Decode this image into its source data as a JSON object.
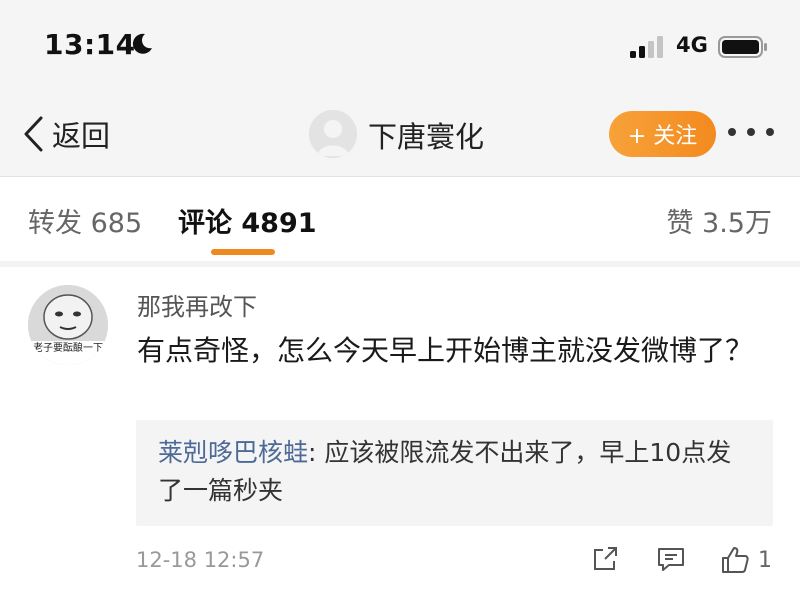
{
  "status_bar": {
    "time": "13:14",
    "network": "4G",
    "moon_icon": "do-not-disturb-moon-icon",
    "signal_icon": "signal-bars-icon",
    "battery_icon": "battery-icon"
  },
  "nav": {
    "back_label": "返回",
    "title": "下唐寰化",
    "follow_label": "+ 关注",
    "more_icon": "more-dots-icon",
    "accent_color": "#f38a1e"
  },
  "tabs": {
    "repost": "转发 685",
    "comment": "评论 4891",
    "like": "赞 3.5万"
  },
  "comment": {
    "author": "那我再改下",
    "text": "有点奇怪，怎么今天早上开始博主就没发微博了？",
    "reply": {
      "author": "莱剋哆巴核蛙",
      "text": ": 应该被限流发不出来了，早上10点发了一篇秒夹"
    },
    "time": "12-18 12:57",
    "like_count": "1",
    "avatar_caption": "老子要酝酿一下"
  }
}
